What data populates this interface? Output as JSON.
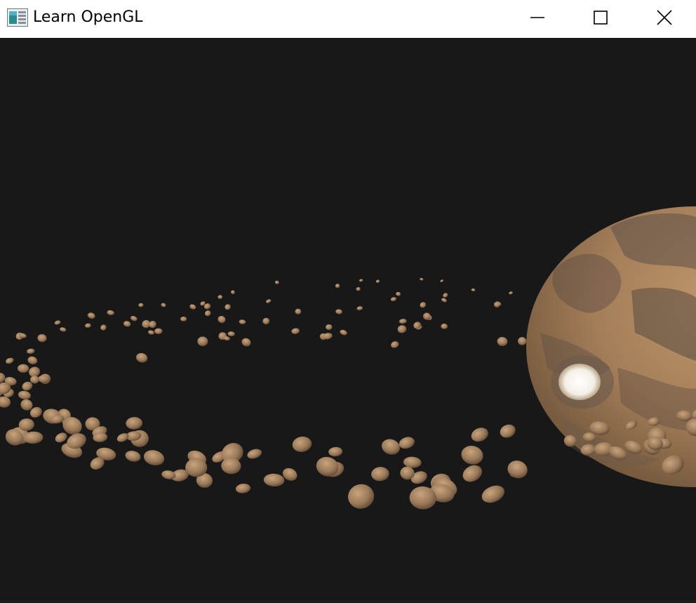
{
  "window": {
    "title": "Learn OpenGL",
    "app_icon": "opengl-window-icon",
    "controls": {
      "minimize_icon": "minimize-icon",
      "maximize_icon": "maximize-icon",
      "close_icon": "close-icon"
    }
  },
  "scene": {
    "background_color": "#181818",
    "planet_color": "#a47e59",
    "asteroid_color": "#9a7a5a"
  }
}
